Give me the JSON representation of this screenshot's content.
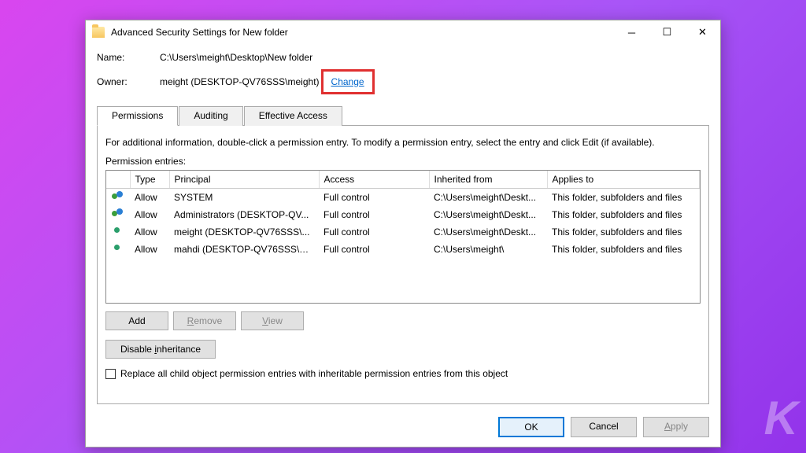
{
  "window": {
    "title": "Advanced Security Settings for New folder"
  },
  "info": {
    "name_label": "Name:",
    "name_value": "C:\\Users\\meight\\Desktop\\New folder",
    "owner_label": "Owner:",
    "owner_value": "meight (DESKTOP-QV76SSS\\meight)",
    "change_label": "Change"
  },
  "tabs": {
    "permissions": "Permissions",
    "auditing": "Auditing",
    "effective": "Effective Access"
  },
  "panel": {
    "hint": "For additional information, double-click a permission entry. To modify a permission entry, select the entry and click Edit (if available).",
    "entries_label": "Permission entries:"
  },
  "columns": {
    "type": "Type",
    "principal": "Principal",
    "access": "Access",
    "inherited": "Inherited from",
    "applies": "Applies to"
  },
  "rows": [
    {
      "icon": "group",
      "type": "Allow",
      "principal": "SYSTEM",
      "access": "Full control",
      "inherited": "C:\\Users\\meight\\Deskt...",
      "applies": "This folder, subfolders and files"
    },
    {
      "icon": "group",
      "type": "Allow",
      "principal": "Administrators (DESKTOP-QV...",
      "access": "Full control",
      "inherited": "C:\\Users\\meight\\Deskt...",
      "applies": "This folder, subfolders and files"
    },
    {
      "icon": "single",
      "type": "Allow",
      "principal": "meight (DESKTOP-QV76SSS\\...",
      "access": "Full control",
      "inherited": "C:\\Users\\meight\\Deskt...",
      "applies": "This folder, subfolders and files"
    },
    {
      "icon": "single",
      "type": "Allow",
      "principal": "mahdi (DESKTOP-QV76SSS\\m...",
      "access": "Full control",
      "inherited": "C:\\Users\\meight\\",
      "applies": "This folder, subfolders and files"
    }
  ],
  "buttons": {
    "add": "Add",
    "remove": "Remove",
    "view": "View",
    "disable_inheritance": "Disable inheritance"
  },
  "checkbox": {
    "replace": "Replace all child object permission entries with inheritable permission entries from this object"
  },
  "footer": {
    "ok": "OK",
    "cancel": "Cancel",
    "apply": "Apply"
  }
}
